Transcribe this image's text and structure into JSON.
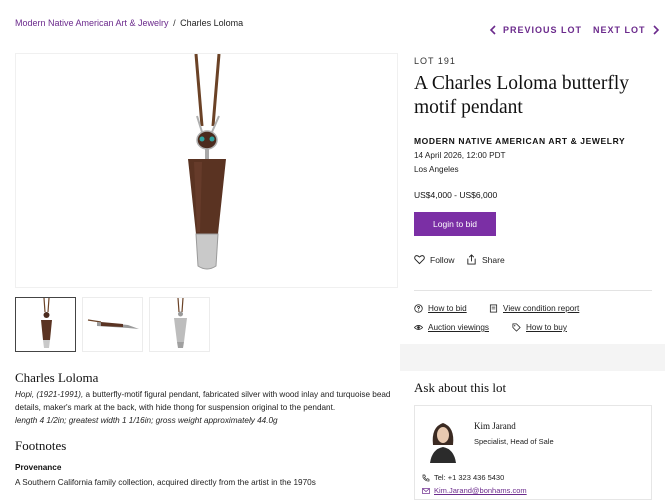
{
  "breadcrumb": {
    "parent": "Modern Native American Art & Jewelry",
    "separator": "/",
    "current": "Charles Loloma"
  },
  "nav": {
    "previous_label": "PREVIOUS LOT",
    "next_label": "NEXT LOT"
  },
  "lot": {
    "number": "LOT 191",
    "title": "A Charles Loloma butterfly motif pendant",
    "sale_name": "MODERN NATIVE AMERICAN ART & JEWELRY",
    "sale_date": "14 April 2026, 12:00 PDT",
    "location": "Los Angeles",
    "estimate": "US$4,000 - US$6,000",
    "bid_button": "Login to bid",
    "follow_label": "Follow",
    "share_label": "Share"
  },
  "links": {
    "how_to_bid": "How to bid",
    "condition_report": "View condition report",
    "auction_viewings": "Auction viewings",
    "how_to_buy": "How to buy"
  },
  "description": {
    "maker": "Charles Loloma",
    "line1_italic": "Hopi, (1921-1991),",
    "line1_rest": " a butterfly-motif figural pendant, fabricated silver with wood inlay and turquoise bead details, maker's mark at the back, with hide thong for suspension original to the pendant.",
    "dimensions": "length 4 1/2in; greatest width 1 1/16in; gross weight approximately 44.0g"
  },
  "footnotes": {
    "heading": "Footnotes",
    "provenance_heading": "Provenance",
    "provenance_text": "A Southern California family collection, acquired directly from the artist in the 1970s"
  },
  "contact": {
    "heading": "Ask about this lot",
    "name": "Kim Jarand",
    "role": "Specialist, Head of Sale",
    "phone": "Tel: +1 323 436 5430",
    "email": "Kim.Jarand@bonhams.com"
  },
  "colors": {
    "accent": "#7b2fa5",
    "link": "#6b2a8c"
  }
}
